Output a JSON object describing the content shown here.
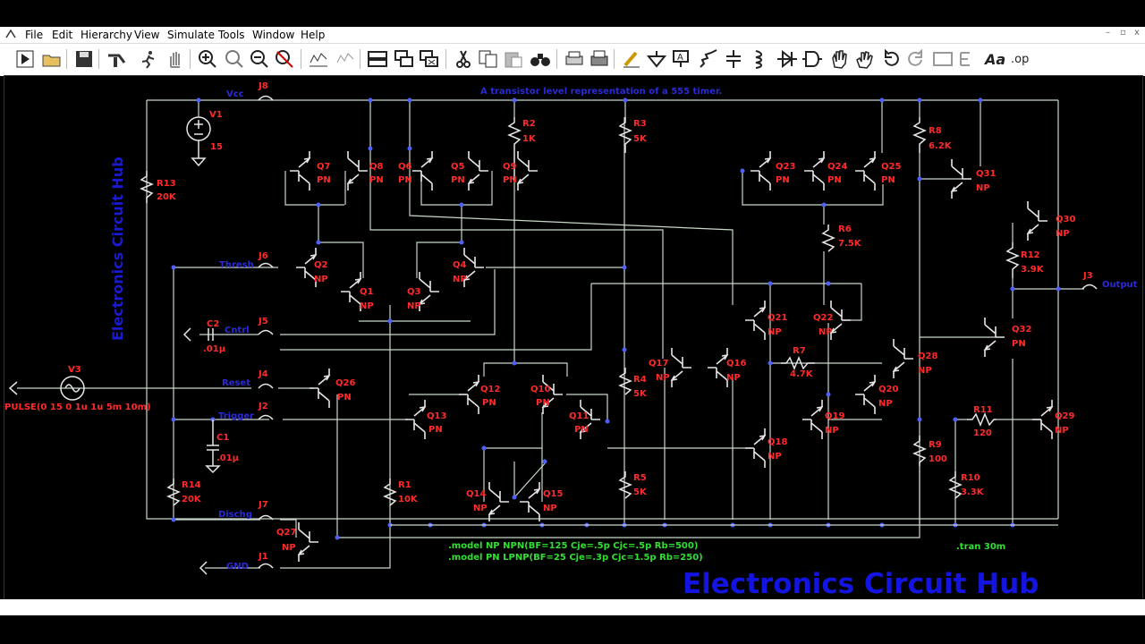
{
  "menu": [
    "File",
    "Edit",
    "Hierarchy",
    "View",
    "Simulate",
    "Tools",
    "Window",
    "Help"
  ],
  "window_controls": [
    "–",
    "▫",
    "x"
  ],
  "toolbar_icons": [
    "run-icon",
    "open-icon",
    "save-icon",
    "control-panel-icon",
    "halt-icon",
    "pan-icon",
    "zoom-in-icon",
    "zoom-fit-icon",
    "zoom-out-icon",
    "cancel-zoom-icon",
    "autorange-icon",
    "pick-visible-traces-icon",
    "tile-icon",
    "cascade-icon",
    "close-all-icon",
    "cut-icon",
    "copy-icon",
    "paste-icon",
    "find-icon",
    "print-preview-icon",
    "print-icon",
    "draw-wire-icon",
    "ground-icon",
    "label-net-icon",
    "resistor-icon",
    "capacitor-icon",
    "inductor-icon",
    "diode-icon",
    "component-icon",
    "move-icon",
    "drag-icon",
    "undo-icon",
    "redo-icon",
    "rotate-icon",
    "mirror-icon",
    "text-icon",
    "spice-directive-icon"
  ],
  "schematic": {
    "title_note": "A transistor level representation of a 555 timer.",
    "watermark_vertical": "Electronics Circuit Hub",
    "watermark_bottom": "Electronics Circuit Hub",
    "model_npn": ".model NP NPN(BF=125 Cje=.5p Cjc=.5p Rb=500)",
    "model_pnp": ".model PN LPNP(BF=25 Cje=.3p Cjc=1.5p Rb=250)",
    "tran": ".tran 30m",
    "v3_value": "PULSE(0 15 0 1u 1u 5m 10m)",
    "nets": {
      "vcc": "Vcc",
      "thresh": "Thresh",
      "cntrl": "Cntrl",
      "reset": "Reset",
      "trigger": "Trigger",
      "dischg": "Dischg",
      "gnd": "GND",
      "output": "Output"
    },
    "transistors": [
      {
        "name": "Q7",
        "type": "PN"
      },
      {
        "name": "Q8",
        "type": "PN"
      },
      {
        "name": "Q6",
        "type": "PN"
      },
      {
        "name": "Q5",
        "type": "PN"
      },
      {
        "name": "Q9",
        "type": "PN"
      },
      {
        "name": "Q23",
        "type": "PN"
      },
      {
        "name": "Q24",
        "type": "PN"
      },
      {
        "name": "Q25",
        "type": "PN"
      },
      {
        "name": "Q31",
        "type": "NP"
      },
      {
        "name": "Q30",
        "type": "NP"
      },
      {
        "name": "Q2",
        "type": "NP"
      },
      {
        "name": "Q1",
        "type": "NP"
      },
      {
        "name": "Q3",
        "type": "NP"
      },
      {
        "name": "Q4",
        "type": "NP"
      },
      {
        "name": "Q21",
        "type": "NP"
      },
      {
        "name": "Q22",
        "type": "NP"
      },
      {
        "name": "Q32",
        "type": "PN"
      },
      {
        "name": "Q17",
        "type": "NP"
      },
      {
        "name": "Q16",
        "type": "NP"
      },
      {
        "name": "Q28",
        "type": "NP"
      },
      {
        "name": "Q26",
        "type": "PN"
      },
      {
        "name": "Q12",
        "type": "PN"
      },
      {
        "name": "Q10",
        "type": "PN"
      },
      {
        "name": "Q13",
        "type": "PN"
      },
      {
        "name": "Q11",
        "type": "PN"
      },
      {
        "name": "Q20",
        "type": "NP"
      },
      {
        "name": "Q19",
        "type": "NP"
      },
      {
        "name": "Q29",
        "type": "NP"
      },
      {
        "name": "Q18",
        "type": "NP"
      },
      {
        "name": "Q14",
        "type": "NP"
      },
      {
        "name": "Q15",
        "type": "NP"
      },
      {
        "name": "Q27",
        "type": "NP"
      }
    ],
    "resistors": [
      {
        "name": "R2",
        "value": "1K"
      },
      {
        "name": "R3",
        "value": "5K"
      },
      {
        "name": "R8",
        "value": "6.2K"
      },
      {
        "name": "R13",
        "value": "20K"
      },
      {
        "name": "R6",
        "value": "7.5K"
      },
      {
        "name": "R12",
        "value": "3.9K"
      },
      {
        "name": "R7",
        "value": "4.7K"
      },
      {
        "name": "R4",
        "value": "5K"
      },
      {
        "name": "R11",
        "value": "120"
      },
      {
        "name": "R9",
        "value": "100"
      },
      {
        "name": "R10",
        "value": "3.3K"
      },
      {
        "name": "R5",
        "value": "5K"
      },
      {
        "name": "R14",
        "value": "20K"
      },
      {
        "name": "R1",
        "value": "10K"
      }
    ],
    "sources": [
      {
        "name": "V1",
        "value": "15"
      },
      {
        "name": "V3",
        "value": ""
      }
    ],
    "capacitors": [
      {
        "name": "C2",
        "value": ".01µ"
      },
      {
        "name": "C1",
        "value": ".01µ"
      }
    ],
    "junctions": [
      "J8",
      "J6",
      "J5",
      "J4",
      "J2",
      "J7",
      "J1",
      "J3"
    ]
  },
  "colors": {
    "wire": "#c8d8c8",
    "component": "#e0e0e0",
    "label": "#ff2020",
    "net": "#1818c8",
    "directive": "#20d020",
    "watermark": "#1010c8"
  }
}
